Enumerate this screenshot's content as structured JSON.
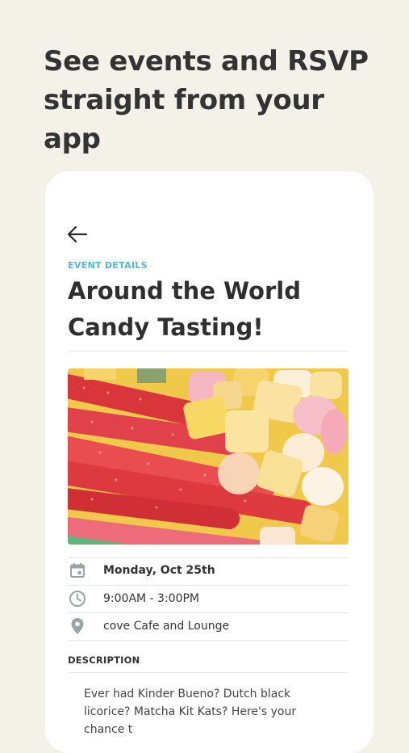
{
  "promo": {
    "headline": "See events and RSVP straight from your app"
  },
  "event": {
    "section_label": "EVENT DETAILS",
    "title": "Around the World Candy Tasting!",
    "image_icon": "candy-photo",
    "date": "Monday, Oct 25th",
    "time": "9:00AM - 3:00PM",
    "location": "cove Cafe and Lounge",
    "description_label": "DESCRIPTION",
    "description": "Ever had Kinder Bueno? Dutch black licorice? Matcha Kit Kats? Here's your chance t"
  },
  "icons": {
    "back": "arrow-left-icon",
    "date": "calendar-icon",
    "time": "clock-icon",
    "location": "location-pin-icon"
  },
  "colors": {
    "background": "#f4f1e9",
    "accent": "#4fb8d6",
    "card": "#ffffff"
  }
}
